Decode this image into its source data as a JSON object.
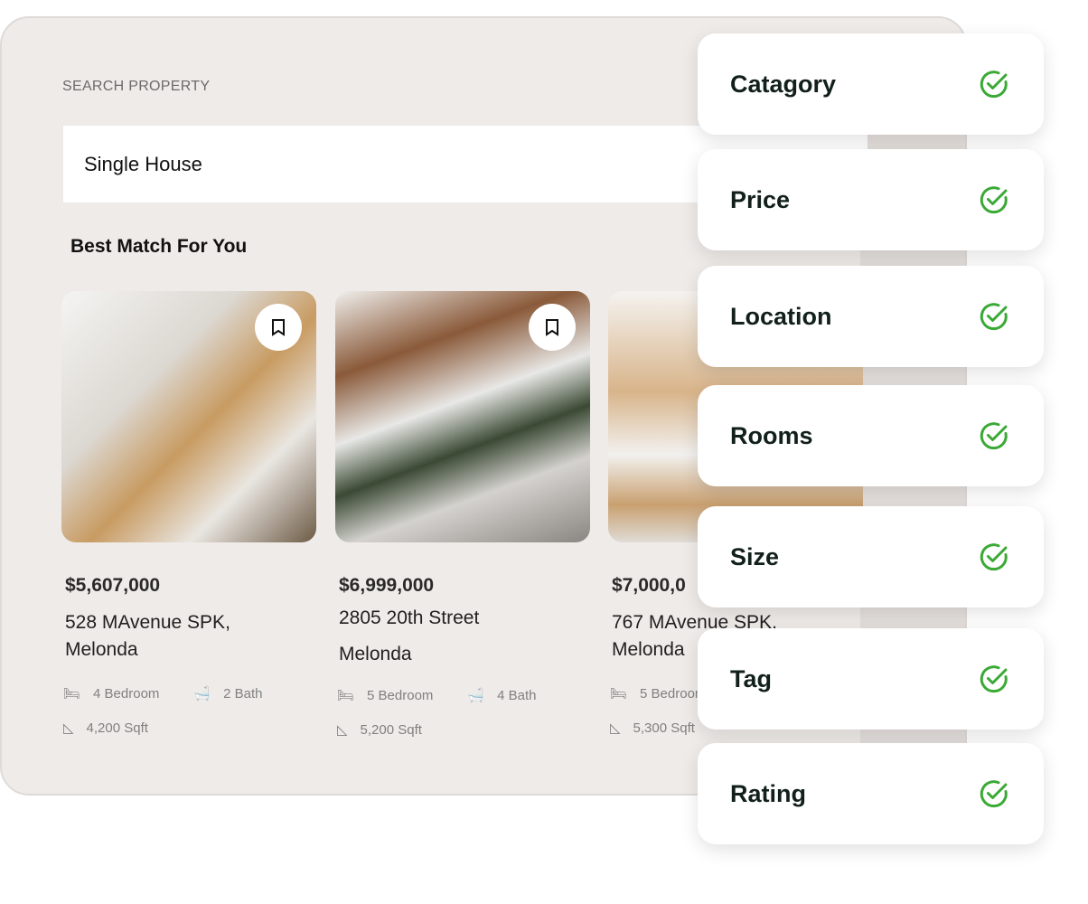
{
  "search": {
    "label": "SEARCH PROPERTY",
    "value": "Single House"
  },
  "heading": "Best Match For You",
  "listings": [
    {
      "price": "$5,607,000",
      "address": "528 MAvenue SPK, Melonda",
      "bedrooms": "4 Bedroom",
      "baths": "2 Bath",
      "size": "4,200 Sqft"
    },
    {
      "price": "$6,999,000",
      "address": "2805 20th Street Melonda",
      "bedrooms": "5 Bedroom",
      "baths": "4 Bath",
      "size": "5,200 Sqft"
    },
    {
      "price": "$7,000,0",
      "address": "767 MAvenue SPK, Melonda",
      "bedrooms": "5 Bedroom",
      "baths": "",
      "size": "5,300 Sqft"
    }
  ],
  "filters": [
    {
      "label": "Catagory",
      "checked": true
    },
    {
      "label": "Price",
      "checked": true
    },
    {
      "label": "Location",
      "checked": true
    },
    {
      "label": "Rooms",
      "checked": true
    },
    {
      "label": "Size",
      "checked": true
    },
    {
      "label": "Tag",
      "checked": true
    },
    {
      "label": "Rating",
      "checked": true
    }
  ],
  "colors": {
    "check": "#3aa935",
    "panel": "#efebe8"
  }
}
